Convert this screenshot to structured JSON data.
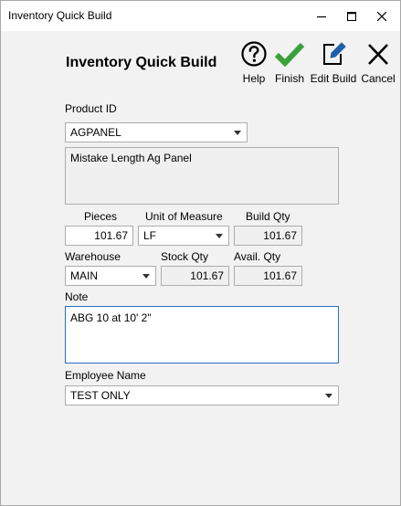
{
  "window": {
    "title": "Inventory Quick Build"
  },
  "header": {
    "heading": "Inventory Quick Build"
  },
  "toolbar": {
    "help_label": "Help",
    "finish_label": "Finish",
    "edit_build_label": "Edit Build",
    "cancel_label": "Cancel",
    "finish_color": "#3aa13a",
    "edit_color": "#1f5fa8"
  },
  "form": {
    "product_id_label": "Product ID",
    "product_id_value": "AGPANEL",
    "description": "Mistake Length Ag Panel",
    "pieces_label": "Pieces",
    "pieces_value": "101.67",
    "uom_label": "Unit of Measure",
    "uom_value": "LF",
    "build_qty_label": "Build Qty",
    "build_qty_value": "101.67",
    "warehouse_label": "Warehouse",
    "warehouse_value": "MAIN",
    "stock_qty_label": "Stock Qty",
    "stock_qty_value": "101.67",
    "avail_qty_label": "Avail. Qty",
    "avail_qty_value": "101.67",
    "note_label": "Note",
    "note_value": "ABG 10 at 10' 2\"",
    "employee_label": "Employee Name",
    "employee_value": "TEST ONLY"
  }
}
